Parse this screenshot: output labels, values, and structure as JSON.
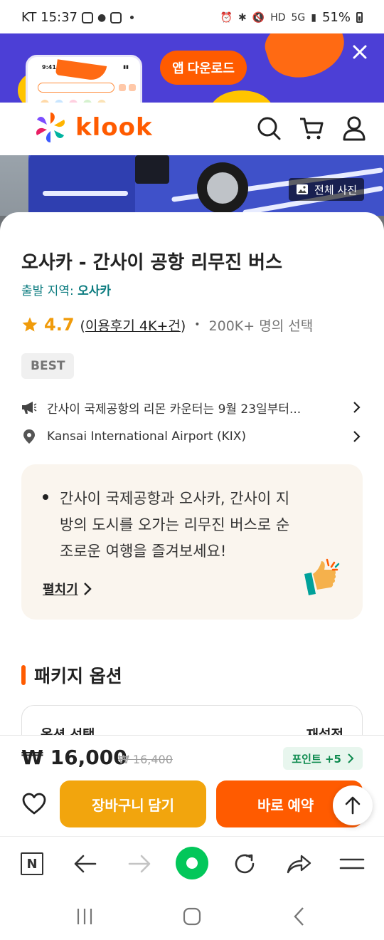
{
  "status_bar": {
    "carrier_time": "KT 15:37",
    "battery": "51%",
    "icons": [
      "instagram-icon",
      "kakaotalk-icon",
      "instagram-icon",
      "alarm-icon",
      "bluetooth-icon",
      "mute-icon",
      "hd-icon",
      "5g-icon",
      "signal-icon",
      "battery-icon"
    ]
  },
  "promo": {
    "download_label": "앱 다운로드",
    "mock_time": "9:41"
  },
  "header": {
    "logo_text": "klook",
    "icons": [
      "search-icon",
      "cart-icon",
      "user-icon"
    ]
  },
  "hero": {
    "all_photos_label": "전체 사진"
  },
  "product": {
    "title": "오사카 - 간사이 공항 리무진 버스",
    "departure_label": "출발 지역:",
    "departure_value": "오사카",
    "rating": "4.7",
    "review_open": "(",
    "review_text": "이용후기 4K+건",
    "review_close": ")",
    "chosen_text": "200K+ 명의 선택",
    "badge": "BEST",
    "notice_text": "간사이 국제공항의 리몬 카운터는 9월 23일부터...",
    "location_text": "Kansai International Airport (KIX)",
    "highlight_text": "간사이 국제공항과 오사카, 간사이 지방의 도시를 오가는 리무진 버스로 순조로운 여행을 즐겨보세요!",
    "expand_label": "펼치기"
  },
  "package": {
    "section_title": "패키지 옵션",
    "option_label": "옵션 선택",
    "reset_label": "재설정"
  },
  "purchase": {
    "price": "₩ 16,000",
    "old_price": "₩ 16,400",
    "points_label": "포인트 +5",
    "cart_label": "장바구니 담기",
    "book_label": "바로 예약"
  },
  "colors": {
    "brand": "#ff5b00",
    "cart": "#f2a50d",
    "promo_bg": "#4c3fd6",
    "rating": "#f09b0a",
    "teal": "#0b7b7f",
    "naver_green": "#03c75a"
  }
}
